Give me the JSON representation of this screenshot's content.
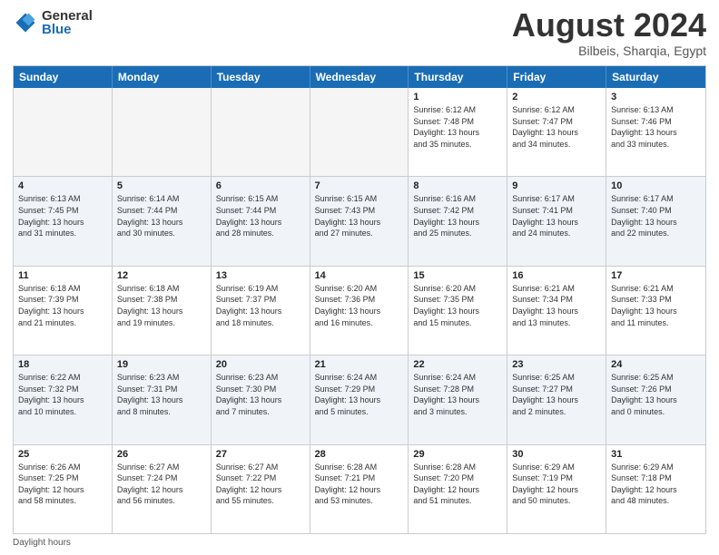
{
  "logo": {
    "general": "General",
    "blue": "Blue"
  },
  "title": {
    "month": "August 2024",
    "location": "Bilbeis, Sharqia, Egypt"
  },
  "days_of_week": [
    "Sunday",
    "Monday",
    "Tuesday",
    "Wednesday",
    "Thursday",
    "Friday",
    "Saturday"
  ],
  "weeks": [
    [
      {
        "day": "",
        "info": "",
        "empty": true
      },
      {
        "day": "",
        "info": "",
        "empty": true
      },
      {
        "day": "",
        "info": "",
        "empty": true
      },
      {
        "day": "",
        "info": "",
        "empty": true
      },
      {
        "day": "1",
        "info": "Sunrise: 6:12 AM\nSunset: 7:48 PM\nDaylight: 13 hours\nand 35 minutes.",
        "empty": false
      },
      {
        "day": "2",
        "info": "Sunrise: 6:12 AM\nSunset: 7:47 PM\nDaylight: 13 hours\nand 34 minutes.",
        "empty": false
      },
      {
        "day": "3",
        "info": "Sunrise: 6:13 AM\nSunset: 7:46 PM\nDaylight: 13 hours\nand 33 minutes.",
        "empty": false
      }
    ],
    [
      {
        "day": "4",
        "info": "Sunrise: 6:13 AM\nSunset: 7:45 PM\nDaylight: 13 hours\nand 31 minutes.",
        "empty": false
      },
      {
        "day": "5",
        "info": "Sunrise: 6:14 AM\nSunset: 7:44 PM\nDaylight: 13 hours\nand 30 minutes.",
        "empty": false
      },
      {
        "day": "6",
        "info": "Sunrise: 6:15 AM\nSunset: 7:44 PM\nDaylight: 13 hours\nand 28 minutes.",
        "empty": false
      },
      {
        "day": "7",
        "info": "Sunrise: 6:15 AM\nSunset: 7:43 PM\nDaylight: 13 hours\nand 27 minutes.",
        "empty": false
      },
      {
        "day": "8",
        "info": "Sunrise: 6:16 AM\nSunset: 7:42 PM\nDaylight: 13 hours\nand 25 minutes.",
        "empty": false
      },
      {
        "day": "9",
        "info": "Sunrise: 6:17 AM\nSunset: 7:41 PM\nDaylight: 13 hours\nand 24 minutes.",
        "empty": false
      },
      {
        "day": "10",
        "info": "Sunrise: 6:17 AM\nSunset: 7:40 PM\nDaylight: 13 hours\nand 22 minutes.",
        "empty": false
      }
    ],
    [
      {
        "day": "11",
        "info": "Sunrise: 6:18 AM\nSunset: 7:39 PM\nDaylight: 13 hours\nand 21 minutes.",
        "empty": false
      },
      {
        "day": "12",
        "info": "Sunrise: 6:18 AM\nSunset: 7:38 PM\nDaylight: 13 hours\nand 19 minutes.",
        "empty": false
      },
      {
        "day": "13",
        "info": "Sunrise: 6:19 AM\nSunset: 7:37 PM\nDaylight: 13 hours\nand 18 minutes.",
        "empty": false
      },
      {
        "day": "14",
        "info": "Sunrise: 6:20 AM\nSunset: 7:36 PM\nDaylight: 13 hours\nand 16 minutes.",
        "empty": false
      },
      {
        "day": "15",
        "info": "Sunrise: 6:20 AM\nSunset: 7:35 PM\nDaylight: 13 hours\nand 15 minutes.",
        "empty": false
      },
      {
        "day": "16",
        "info": "Sunrise: 6:21 AM\nSunset: 7:34 PM\nDaylight: 13 hours\nand 13 minutes.",
        "empty": false
      },
      {
        "day": "17",
        "info": "Sunrise: 6:21 AM\nSunset: 7:33 PM\nDaylight: 13 hours\nand 11 minutes.",
        "empty": false
      }
    ],
    [
      {
        "day": "18",
        "info": "Sunrise: 6:22 AM\nSunset: 7:32 PM\nDaylight: 13 hours\nand 10 minutes.",
        "empty": false
      },
      {
        "day": "19",
        "info": "Sunrise: 6:23 AM\nSunset: 7:31 PM\nDaylight: 13 hours\nand 8 minutes.",
        "empty": false
      },
      {
        "day": "20",
        "info": "Sunrise: 6:23 AM\nSunset: 7:30 PM\nDaylight: 13 hours\nand 7 minutes.",
        "empty": false
      },
      {
        "day": "21",
        "info": "Sunrise: 6:24 AM\nSunset: 7:29 PM\nDaylight: 13 hours\nand 5 minutes.",
        "empty": false
      },
      {
        "day": "22",
        "info": "Sunrise: 6:24 AM\nSunset: 7:28 PM\nDaylight: 13 hours\nand 3 minutes.",
        "empty": false
      },
      {
        "day": "23",
        "info": "Sunrise: 6:25 AM\nSunset: 7:27 PM\nDaylight: 13 hours\nand 2 minutes.",
        "empty": false
      },
      {
        "day": "24",
        "info": "Sunrise: 6:25 AM\nSunset: 7:26 PM\nDaylight: 13 hours\nand 0 minutes.",
        "empty": false
      }
    ],
    [
      {
        "day": "25",
        "info": "Sunrise: 6:26 AM\nSunset: 7:25 PM\nDaylight: 12 hours\nand 58 minutes.",
        "empty": false
      },
      {
        "day": "26",
        "info": "Sunrise: 6:27 AM\nSunset: 7:24 PM\nDaylight: 12 hours\nand 56 minutes.",
        "empty": false
      },
      {
        "day": "27",
        "info": "Sunrise: 6:27 AM\nSunset: 7:22 PM\nDaylight: 12 hours\nand 55 minutes.",
        "empty": false
      },
      {
        "day": "28",
        "info": "Sunrise: 6:28 AM\nSunset: 7:21 PM\nDaylight: 12 hours\nand 53 minutes.",
        "empty": false
      },
      {
        "day": "29",
        "info": "Sunrise: 6:28 AM\nSunset: 7:20 PM\nDaylight: 12 hours\nand 51 minutes.",
        "empty": false
      },
      {
        "day": "30",
        "info": "Sunrise: 6:29 AM\nSunset: 7:19 PM\nDaylight: 12 hours\nand 50 minutes.",
        "empty": false
      },
      {
        "day": "31",
        "info": "Sunrise: 6:29 AM\nSunset: 7:18 PM\nDaylight: 12 hours\nand 48 minutes.",
        "empty": false
      }
    ]
  ],
  "footer": {
    "daylight_label": "Daylight hours"
  }
}
